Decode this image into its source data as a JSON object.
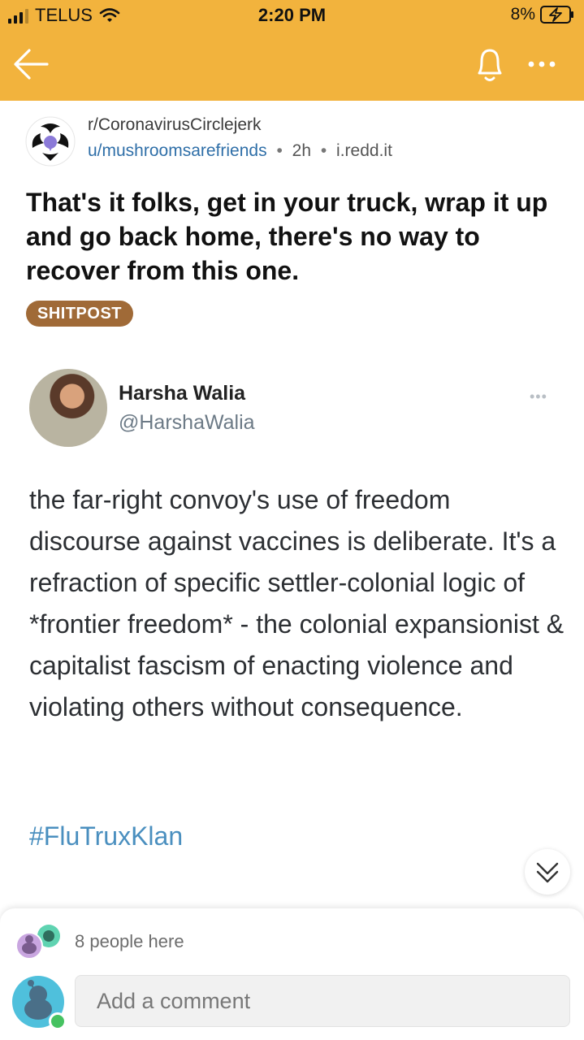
{
  "status_bar": {
    "carrier": "TELUS",
    "time": "2:20 PM",
    "battery": "8%"
  },
  "nav": {
    "back_icon": "arrow-left-icon",
    "bell_icon": "bell-icon",
    "more_icon": "more-dots-icon"
  },
  "post": {
    "subreddit": "r/CoronavirusCirclejerk",
    "author": "u/mushroomsarefriends",
    "sep1": "•",
    "age": "2h",
    "sep2": "•",
    "domain": "i.redd.it",
    "title": "That's it folks, get in your truck, wrap it up and go back home, there's no way to recover from this one.",
    "flair": "SHITPOST"
  },
  "tweet": {
    "name": "Harsha Walia",
    "handle": "@HarshaWalia",
    "menu": "•••",
    "body": "the far-right convoy's use of freedom discourse against vaccines is deliberate. It's a refraction of specific settler-colonial logic of *frontier freedom* - the colonial expansionist & capitalist fascism of enacting violence and violating others without consequence.",
    "hashtag": "#FluTruxKlan"
  },
  "comments_bar": {
    "people_here": "8 people here",
    "input_placeholder": "Add a comment"
  },
  "colors": {
    "header": "#f2b33d",
    "flair": "#a06a37",
    "link": "#2f6fa8",
    "hashtag": "#4a8fbf",
    "online": "#46c261"
  }
}
